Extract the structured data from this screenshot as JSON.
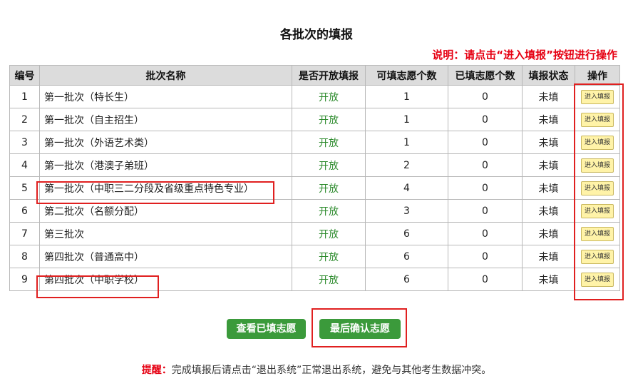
{
  "page": {
    "title": "各批次的填报",
    "instruction": "说明：请点击“进入填报”按钮进行操作"
  },
  "table": {
    "headers": [
      "编号",
      "批次名称",
      "是否开放填报",
      "可填志愿个数",
      "已填志愿个数",
      "填报状态",
      "操作"
    ],
    "rows": [
      {
        "no": "1",
        "name": "第一批次（特长生）",
        "open": "开放",
        "allowed": "1",
        "filled": "0",
        "status": "未填",
        "action": "进入填报"
      },
      {
        "no": "2",
        "name": "第一批次（自主招生）",
        "open": "开放",
        "allowed": "1",
        "filled": "0",
        "status": "未填",
        "action": "进入填报"
      },
      {
        "no": "3",
        "name": "第一批次（外语艺术类）",
        "open": "开放",
        "allowed": "1",
        "filled": "0",
        "status": "未填",
        "action": "进入填报"
      },
      {
        "no": "4",
        "name": "第一批次（港澳子弟班）",
        "open": "开放",
        "allowed": "2",
        "filled": "0",
        "status": "未填",
        "action": "进入填报"
      },
      {
        "no": "5",
        "name": "第一批次（中职三二分段及省级重点特色专业）",
        "open": "开放",
        "allowed": "4",
        "filled": "0",
        "status": "未填",
        "action": "进入填报"
      },
      {
        "no": "6",
        "name": "第二批次（名额分配）",
        "open": "开放",
        "allowed": "3",
        "filled": "0",
        "status": "未填",
        "action": "进入填报"
      },
      {
        "no": "7",
        "name": "第三批次",
        "open": "开放",
        "allowed": "6",
        "filled": "0",
        "status": "未填",
        "action": "进入填报"
      },
      {
        "no": "8",
        "name": "第四批次（普通高中）",
        "open": "开放",
        "allowed": "6",
        "filled": "0",
        "status": "未填",
        "action": "进入填报"
      },
      {
        "no": "9",
        "name": "第四批次（中职学校）",
        "open": "开放",
        "allowed": "6",
        "filled": "0",
        "status": "未填",
        "action": "进入填报"
      }
    ]
  },
  "buttons": {
    "view_filled": "查看已填志愿",
    "final_confirm": "最后确认志愿"
  },
  "reminder": {
    "label": "提醒：",
    "text": "完成填报后请点击“退出系统”正常退出系统，避免与其他考生数据冲突。"
  },
  "colors": {
    "accent_red": "#e60012",
    "button_green": "#3b9a3b",
    "open_green": "#2d8b2d",
    "enter_button_bg": "#fff3a8"
  }
}
